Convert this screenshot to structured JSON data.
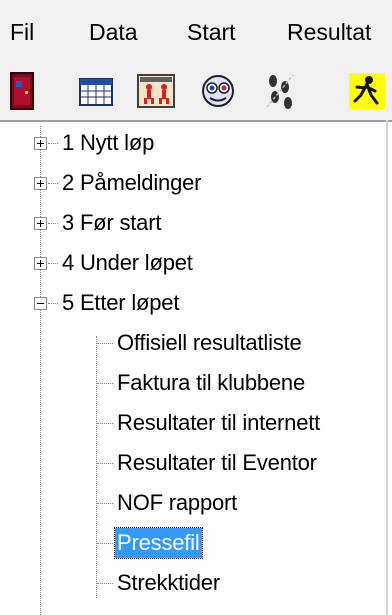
{
  "menu": {
    "items": [
      "Fil",
      "Data",
      "Start",
      "Resultat"
    ]
  },
  "toolbar": {
    "buttons": [
      "exit-door-icon",
      "calendar-icon",
      "runners-icon",
      "eye-icon",
      "footprints-icon",
      "runner-icon"
    ]
  },
  "tree": {
    "sections": [
      {
        "label": "1 Nytt løp",
        "expanded": false
      },
      {
        "label": "2 Påmeldinger",
        "expanded": false
      },
      {
        "label": "3 Før start",
        "expanded": false
      },
      {
        "label": "4 Under løpet",
        "expanded": false
      },
      {
        "label": "5 Etter løpet",
        "expanded": true
      }
    ],
    "children": [
      "Offisiell resultatliste",
      "Faktura til klubbene",
      "Resultater til internett",
      "Resultater til Eventor",
      "NOF rapport",
      "Pressefil",
      "Strekktider"
    ],
    "selected": "Pressefil",
    "selection_color": "#3399ff"
  }
}
